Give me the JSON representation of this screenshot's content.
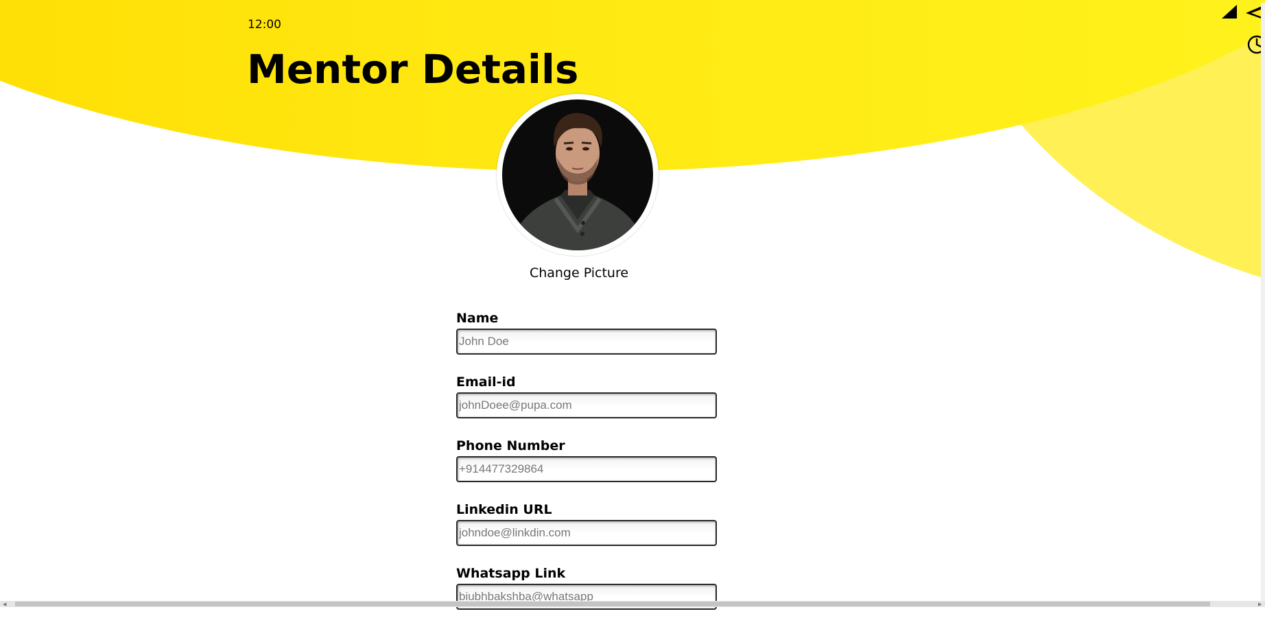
{
  "status_bar": {
    "time": "12:00",
    "icons": [
      "signal-icon",
      "wifi-icon",
      "clock-icon"
    ]
  },
  "header": {
    "title": "Mentor Details"
  },
  "avatar": {
    "action_label": "Change Picture"
  },
  "form": {
    "fields": [
      {
        "label": "Name",
        "placeholder": "John Doe",
        "value": ""
      },
      {
        "label": "Email-id",
        "placeholder": "johnDoee@pupa.com",
        "value": ""
      },
      {
        "label": "Phone Number",
        "placeholder": "+914477329864",
        "value": ""
      },
      {
        "label": "Linkedin URL",
        "placeholder": "johndoe@linkdin.com",
        "value": ""
      },
      {
        "label": "Whatsapp Link",
        "placeholder": "biubhbakshba@whatsapp",
        "value": ""
      }
    ]
  },
  "colors": {
    "accent_yellow": "#ffe812",
    "accent_yellow_light": "#fff055",
    "text": "#000000"
  }
}
